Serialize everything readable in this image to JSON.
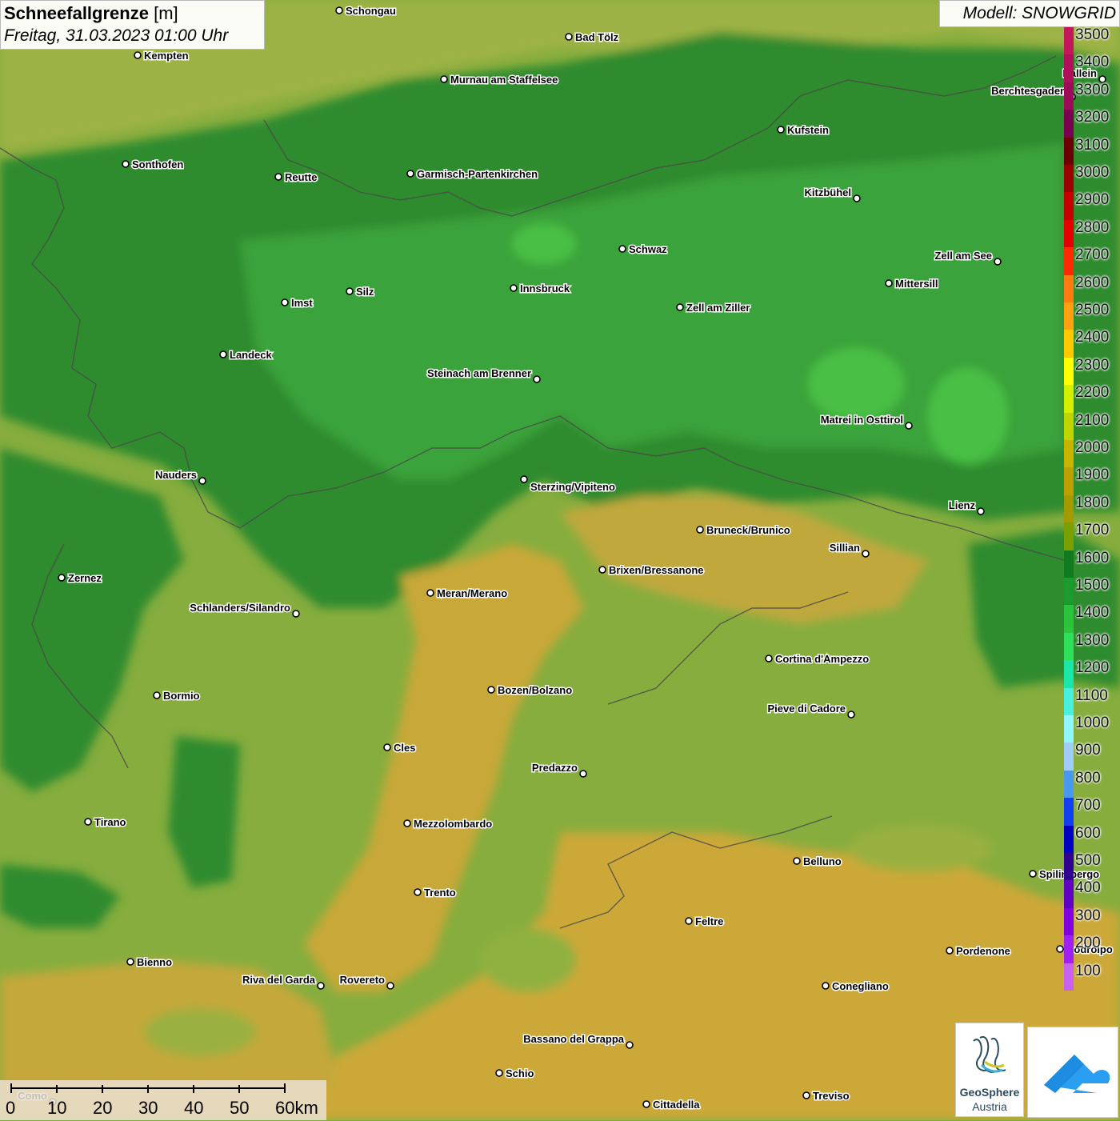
{
  "title": {
    "variable": "Schneefallgrenze",
    "unit": "[m]",
    "datetime": "Freitag, 31.03.2023 01:00 Uhr"
  },
  "model": "Modell: SNOWGRID",
  "legend": {
    "labels": [
      "3500",
      "3400",
      "3300",
      "3200",
      "3100",
      "3000",
      "2900",
      "2800",
      "2700",
      "2600",
      "2500",
      "2400",
      "2300",
      "2200",
      "2100",
      "2000",
      "1900",
      "1800",
      "1700",
      "1600",
      "1500",
      "1400",
      "1300",
      "1200",
      "1100",
      "1000",
      "900",
      "800",
      "700",
      "600",
      "500",
      "400",
      "300",
      "200",
      "100"
    ],
    "colors": [
      "#c2185b",
      "#b0105a",
      "#9c0a58",
      "#7a0050",
      "#6a0000",
      "#9a0000",
      "#c40000",
      "#e40000",
      "#ff2a00",
      "#ff7a10",
      "#ffa010",
      "#ffc800",
      "#ffff00",
      "#d4f000",
      "#c0d400",
      "#c8b400",
      "#bca000",
      "#a49a00",
      "#7aa000",
      "#0f7a1e",
      "#1d9a2d",
      "#2cc43c",
      "#2ee05a",
      "#1be8a8",
      "#48f0e0",
      "#90f8f8",
      "#a0ccf8",
      "#4898f0",
      "#1040f0",
      "#0000c0",
      "#300090",
      "#6000c0",
      "#8000e0",
      "#a020f0",
      "#c860f0"
    ]
  },
  "cities": [
    {
      "name": "Schongau"
    },
    {
      "name": "Kempten"
    },
    {
      "name": "Bad Tölz"
    },
    {
      "name": "Murnau am Staffelsee"
    },
    {
      "name": "Hallein"
    },
    {
      "name": "Berchtesgaden"
    },
    {
      "name": "Kufstein"
    },
    {
      "name": "Sonthofen"
    },
    {
      "name": "Reutte"
    },
    {
      "name": "Garmisch-Partenkirchen"
    },
    {
      "name": "Kitzbühel"
    },
    {
      "name": "Schwaz"
    },
    {
      "name": "Zell am See"
    },
    {
      "name": "Innsbruck"
    },
    {
      "name": "Mittersill"
    },
    {
      "name": "Imst"
    },
    {
      "name": "Silz"
    },
    {
      "name": "Zell am Ziller"
    },
    {
      "name": "Landeck"
    },
    {
      "name": "Steinach am Brenner"
    },
    {
      "name": "Matrei in Osttirol"
    },
    {
      "name": "Nauders"
    },
    {
      "name": "Sterzing/Vipiteno"
    },
    {
      "name": "Lienz"
    },
    {
      "name": "Bruneck/Brunico"
    },
    {
      "name": "Sillian"
    },
    {
      "name": "Brixen/Bressanone"
    },
    {
      "name": "Zernez"
    },
    {
      "name": "Meran/Merano"
    },
    {
      "name": "Schlanders/Silandro"
    },
    {
      "name": "Cortina d'Ampezzo"
    },
    {
      "name": "Bozen/Bolzano"
    },
    {
      "name": "Bormio"
    },
    {
      "name": "Pieve di Cadore"
    },
    {
      "name": "Cles"
    },
    {
      "name": "Predazzo"
    },
    {
      "name": "Tirano"
    },
    {
      "name": "Mezzolombardo"
    },
    {
      "name": "Belluno"
    },
    {
      "name": "Spilimbergo"
    },
    {
      "name": "Trento"
    },
    {
      "name": "Feltre"
    },
    {
      "name": "Pordenone"
    },
    {
      "name": "Codroipo"
    },
    {
      "name": "Bienno"
    },
    {
      "name": "Riva del Garda"
    },
    {
      "name": "Rovereto"
    },
    {
      "name": "Conegliano"
    },
    {
      "name": "Bassano del Grappa"
    },
    {
      "name": "Schio"
    },
    {
      "name": "Treviso"
    },
    {
      "name": "Cittadella"
    },
    {
      "name": "Como"
    }
  ],
  "scale": {
    "ticks": [
      "0",
      "10",
      "20",
      "30",
      "40",
      "50",
      "60km"
    ]
  },
  "logos": {
    "geosphere_line1": "GeoSphere",
    "geosphere_line2": "Austria"
  }
}
